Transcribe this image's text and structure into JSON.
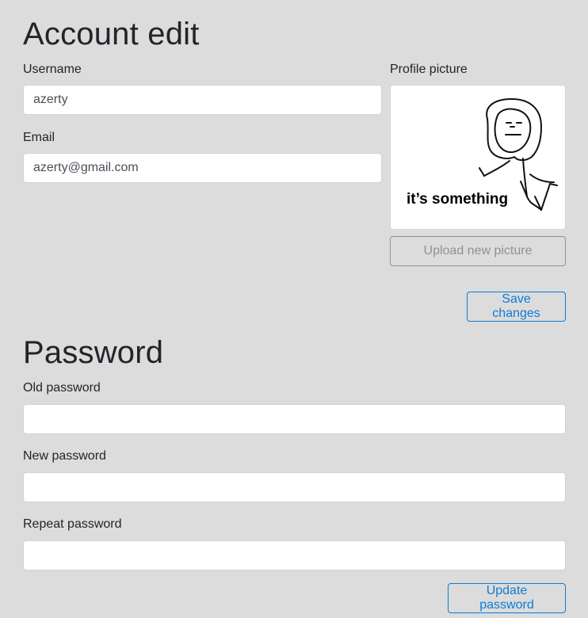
{
  "account": {
    "title": "Account edit",
    "username_label": "Username",
    "username_value": "azerty",
    "email_label": "Email",
    "email_value": "azerty@gmail.com",
    "picture_label": "Profile picture",
    "picture_caption": "it’s something",
    "upload_button": "Upload new picture",
    "save_button": "Save changes"
  },
  "password": {
    "title": "Password",
    "old_label": "Old password",
    "new_label": "New password",
    "repeat_label": "Repeat password",
    "old_value": "",
    "new_value": "",
    "repeat_value": "",
    "update_button": "Update password"
  },
  "colors": {
    "background": "#dcdcdc",
    "primary": "#0d7bd5",
    "secondary": "#8e9296"
  }
}
